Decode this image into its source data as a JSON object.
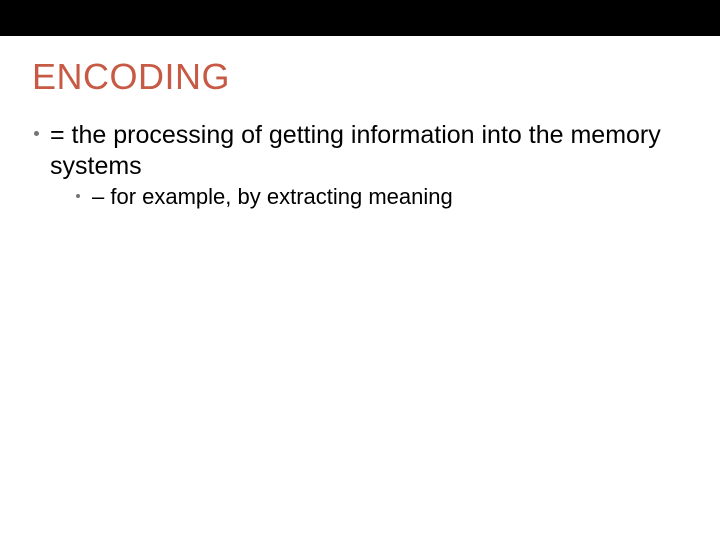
{
  "slide": {
    "title": "ENCODING",
    "bullet1": "= the processing of getting information into the memory systems",
    "bullet2": "– for example, by extracting meaning"
  }
}
